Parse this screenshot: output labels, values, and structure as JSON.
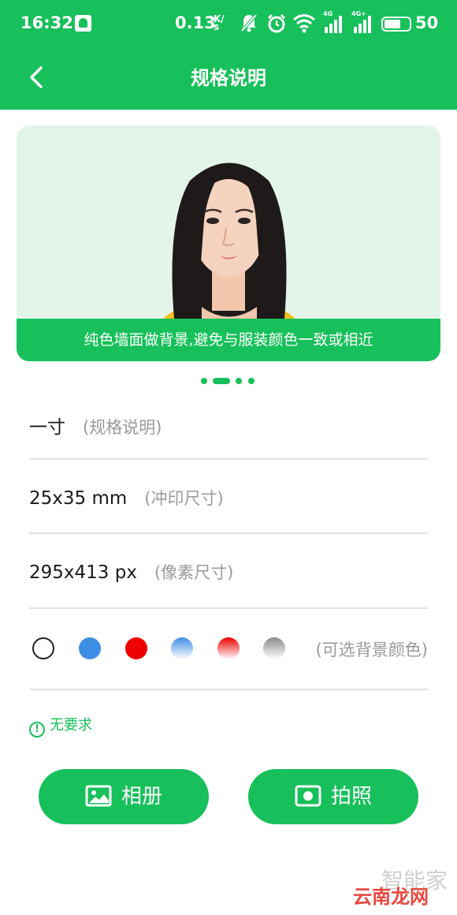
{
  "status_bar": {
    "time": "16:32",
    "speed": "0.13",
    "speed_unit_top": "K/",
    "speed_unit_bottom": "s",
    "net1": "4G",
    "net2": "4G+",
    "battery": "50"
  },
  "header": {
    "title": "规格说明"
  },
  "banner": {
    "caption": "纯色墙面做背景,避免与服装颜色一致或相近",
    "active_page": 2,
    "page_count": 4
  },
  "specs": [
    {
      "value": "一寸",
      "note": "(规格说明)"
    },
    {
      "value": "25x35 mm",
      "note": "(冲印尺寸)"
    },
    {
      "value": "295x413 px",
      "note": "(像素尺寸)"
    }
  ],
  "background_colors": {
    "note": "(可选背景颜色)",
    "swatches": [
      {
        "name": "white",
        "color": "#ffffff"
      },
      {
        "name": "blue",
        "color": "#3f8ee6"
      },
      {
        "name": "red",
        "color": "#ee0000"
      },
      {
        "name": "blue-gradient",
        "color": "#4a90e2"
      },
      {
        "name": "red-gradient",
        "color": "#e53030"
      },
      {
        "name": "gray-gradient",
        "color": "#9a9a9a"
      }
    ]
  },
  "requirement": {
    "icon": "!",
    "text": "无要求"
  },
  "actions": {
    "album": "相册",
    "camera": "拍照"
  },
  "watermark": {
    "line1": "智能家",
    "line2": "云南龙网"
  },
  "colors": {
    "accent": "#17c05a"
  }
}
